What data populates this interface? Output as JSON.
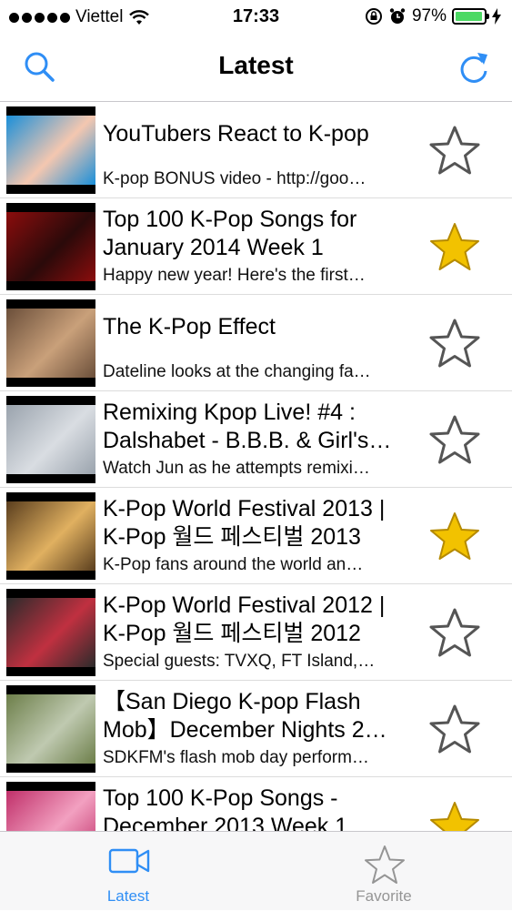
{
  "status_bar": {
    "carrier": "Viettel",
    "time": "17:33",
    "battery": "97%",
    "battery_level": 0.97
  },
  "nav": {
    "title": "Latest",
    "left_icon": "search-icon",
    "right_icon": "refresh-icon"
  },
  "videos": [
    {
      "title": [
        "YouTubers React to K-pop"
      ],
      "desc": "K-pop BONUS video - http://goo…",
      "favorite": false,
      "thumb": [
        "#1a8fd9",
        "#f4c7b0"
      ]
    },
    {
      "title": [
        "Top 100 K-Pop Songs for",
        "January 2014 Week 1"
      ],
      "desc": "Happy new year! Here's the first…",
      "favorite": true,
      "thumb": [
        "#8b0d0d",
        "#2a0a0a"
      ]
    },
    {
      "title": [
        "The K-Pop Effect"
      ],
      "desc": "Dateline looks at the changing fa…",
      "favorite": false,
      "thumb": [
        "#6b4f3a",
        "#c9a07a"
      ]
    },
    {
      "title": [
        "Remixing Kpop Live! #4 :",
        "Dalshabet - B.B.B. & Girl's…"
      ],
      "desc": "Watch Jun as he attempts remixi…",
      "favorite": false,
      "thumb": [
        "#9aa3ad",
        "#d9dde2"
      ]
    },
    {
      "title": [
        "K-Pop World Festival 2013 |",
        "K-Pop 월드 페스티벌 2013"
      ],
      "desc": "K-Pop fans around the world an…",
      "favorite": true,
      "thumb": [
        "#5a3e1e",
        "#e0b060"
      ]
    },
    {
      "title": [
        "K-Pop World Festival 2012 |",
        "K-Pop 월드 페스티벌 2012"
      ],
      "desc": "Special guests: TVXQ, FT Island,…",
      "favorite": false,
      "thumb": [
        "#2b2b2b",
        "#c03040"
      ]
    },
    {
      "title": [
        "【San Diego K-pop Flash",
        "Mob】December Nights 2…"
      ],
      "desc": "SDKFM's flash mob day perform…",
      "favorite": false,
      "thumb": [
        "#6d7f4a",
        "#bfc9b0"
      ]
    },
    {
      "title": [
        "Top 100 K-Pop Songs -",
        "December 2013 Week 1"
      ],
      "desc": "",
      "favorite": true,
      "thumb": [
        "#c0306a",
        "#f2a0c0"
      ]
    }
  ],
  "tabs": {
    "latest": {
      "label": "Latest",
      "icon": "video-camera-icon",
      "active": true
    },
    "favorite": {
      "label": "Favorite",
      "icon": "star-icon",
      "active": false
    }
  },
  "colors": {
    "accent": "#2f8ef5",
    "star_fill": "#f2c200",
    "battery": "#4cd964"
  }
}
